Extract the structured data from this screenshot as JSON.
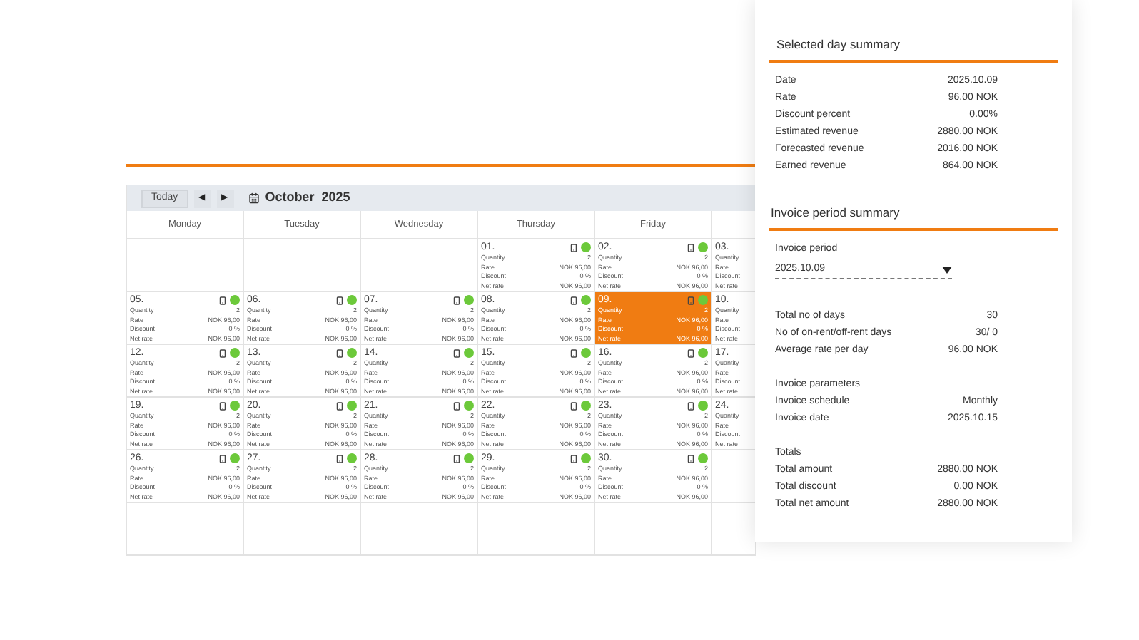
{
  "calendar": {
    "today_button": "Today",
    "prev_button": "◀",
    "next_button": "▶",
    "month": "October  2025",
    "weekdays": [
      "Monday",
      "Tuesday",
      "Wednesday",
      "Thursday",
      "Friday"
    ],
    "weeks": [
      [
        {
          "kind": "empty"
        },
        {
          "kind": "empty"
        },
        {
          "kind": "empty"
        },
        {
          "date": "01.",
          "selected": false,
          "rows": [
            {
              "label": "Quantity",
              "value": "2"
            },
            {
              "label": "Rate",
              "value": "NOK 96,00"
            },
            {
              "label": "Discount",
              "value": "0 %"
            },
            {
              "label": "Net rate",
              "value": "NOK 96,00"
            }
          ]
        },
        {
          "date": "02.",
          "selected": false,
          "rows": [
            {
              "label": "Quantity",
              "value": "2"
            },
            {
              "label": "Rate",
              "value": "NOK 96,00"
            },
            {
              "label": "Discount",
              "value": "0 %"
            },
            {
              "label": "Net rate",
              "value": "NOK 96,00"
            }
          ]
        },
        {
          "date": "03.",
          "kind": "partial",
          "rows": [
            {
              "label": "Quantity"
            },
            {
              "label": "Rate"
            },
            {
              "label": "Discount"
            },
            {
              "label": "Net rate"
            }
          ]
        }
      ],
      [
        {
          "date": "05.",
          "selected": false,
          "rows": [
            {
              "label": "Quantity",
              "value": "2"
            },
            {
              "label": "Rate",
              "value": "NOK 96,00"
            },
            {
              "label": "Discount",
              "value": "0 %"
            },
            {
              "label": "Net rate",
              "value": "NOK 96,00"
            }
          ]
        },
        {
          "date": "06.",
          "selected": false,
          "rows": [
            {
              "label": "Quantity",
              "value": "2"
            },
            {
              "label": "Rate",
              "value": "NOK 96,00"
            },
            {
              "label": "Discount",
              "value": "0 %"
            },
            {
              "label": "Net rate",
              "value": "NOK 96,00"
            }
          ]
        },
        {
          "date": "07.",
          "selected": false,
          "rows": [
            {
              "label": "Quantity",
              "value": "2"
            },
            {
              "label": "Rate",
              "value": "NOK 96,00"
            },
            {
              "label": "Discount",
              "value": "0 %"
            },
            {
              "label": "Net rate",
              "value": "NOK 96,00"
            }
          ]
        },
        {
          "date": "08.",
          "selected": false,
          "rows": [
            {
              "label": "Quantity",
              "value": "2"
            },
            {
              "label": "Rate",
              "value": "NOK 96,00"
            },
            {
              "label": "Discount",
              "value": "0 %"
            },
            {
              "label": "Net rate",
              "value": "NOK 96,00"
            }
          ]
        },
        {
          "date": "09.",
          "selected": true,
          "rows": [
            {
              "label": "Quantity",
              "value": "2"
            },
            {
              "label": "Rate",
              "value": "NOK 96,00"
            },
            {
              "label": "Discount",
              "value": "0 %"
            },
            {
              "label": "Net rate",
              "value": "NOK 96,00"
            }
          ]
        },
        {
          "date": "10.",
          "kind": "partial",
          "rows": [
            {
              "label": "Quantity"
            },
            {
              "label": "Rate"
            },
            {
              "label": "Discount"
            },
            {
              "label": "Net rate"
            }
          ]
        }
      ],
      [
        {
          "date": "12.",
          "selected": false,
          "rows": [
            {
              "label": "Quantity",
              "value": "2"
            },
            {
              "label": "Rate",
              "value": "NOK 96,00"
            },
            {
              "label": "Discount",
              "value": "0 %"
            },
            {
              "label": "Net rate",
              "value": "NOK 96,00"
            }
          ]
        },
        {
          "date": "13.",
          "selected": false,
          "rows": [
            {
              "label": "Quantity",
              "value": "2"
            },
            {
              "label": "Rate",
              "value": "NOK 96,00"
            },
            {
              "label": "Discount",
              "value": "0 %"
            },
            {
              "label": "Net rate",
              "value": "NOK 96,00"
            }
          ]
        },
        {
          "date": "14.",
          "selected": false,
          "rows": [
            {
              "label": "Quantity",
              "value": "2"
            },
            {
              "label": "Rate",
              "value": "NOK 96,00"
            },
            {
              "label": "Discount",
              "value": "0 %"
            },
            {
              "label": "Net rate",
              "value": "NOK 96,00"
            }
          ]
        },
        {
          "date": "15.",
          "selected": false,
          "rows": [
            {
              "label": "Quantity",
              "value": "2"
            },
            {
              "label": "Rate",
              "value": "NOK 96,00"
            },
            {
              "label": "Discount",
              "value": "0 %"
            },
            {
              "label": "Net rate",
              "value": "NOK 96,00"
            }
          ]
        },
        {
          "date": "16.",
          "selected": false,
          "rows": [
            {
              "label": "Quantity",
              "value": "2"
            },
            {
              "label": "Rate",
              "value": "NOK 96,00"
            },
            {
              "label": "Discount",
              "value": "0 %"
            },
            {
              "label": "Net rate",
              "value": "NOK 96,00"
            }
          ]
        },
        {
          "date": "17.",
          "kind": "partial",
          "rows": [
            {
              "label": "Quantity"
            },
            {
              "label": "Rate"
            },
            {
              "label": "Discount"
            },
            {
              "label": "Net rate"
            }
          ]
        }
      ],
      [
        {
          "date": "19.",
          "selected": false,
          "rows": [
            {
              "label": "Quantity",
              "value": "2"
            },
            {
              "label": "Rate",
              "value": "NOK 96,00"
            },
            {
              "label": "Discount",
              "value": "0 %"
            },
            {
              "label": "Net rate",
              "value": "NOK 96,00"
            }
          ]
        },
        {
          "date": "20.",
          "selected": false,
          "rows": [
            {
              "label": "Quantity",
              "value": "2"
            },
            {
              "label": "Rate",
              "value": "NOK 96,00"
            },
            {
              "label": "Discount",
              "value": "0 %"
            },
            {
              "label": "Net rate",
              "value": "NOK 96,00"
            }
          ]
        },
        {
          "date": "21.",
          "selected": false,
          "rows": [
            {
              "label": "Quantity",
              "value": "2"
            },
            {
              "label": "Rate",
              "value": "NOK 96,00"
            },
            {
              "label": "Discount",
              "value": "0 %"
            },
            {
              "label": "Net rate",
              "value": "NOK 96,00"
            }
          ]
        },
        {
          "date": "22.",
          "selected": false,
          "rows": [
            {
              "label": "Quantity",
              "value": "2"
            },
            {
              "label": "Rate",
              "value": "NOK 96,00"
            },
            {
              "label": "Discount",
              "value": "0 %"
            },
            {
              "label": "Net rate",
              "value": "NOK 96,00"
            }
          ]
        },
        {
          "date": "23.",
          "selected": false,
          "rows": [
            {
              "label": "Quantity",
              "value": "2"
            },
            {
              "label": "Rate",
              "value": "NOK 96,00"
            },
            {
              "label": "Discount",
              "value": "0 %"
            },
            {
              "label": "Net rate",
              "value": "NOK 96,00"
            }
          ]
        },
        {
          "date": "24.",
          "kind": "partial",
          "rows": [
            {
              "label": "Quantity"
            },
            {
              "label": "Rate"
            },
            {
              "label": "Discount"
            },
            {
              "label": "Net rate"
            }
          ]
        }
      ],
      [
        {
          "date": "26.",
          "selected": false,
          "rows": [
            {
              "label": "Quantity",
              "value": "2"
            },
            {
              "label": "Rate",
              "value": "NOK 96,00"
            },
            {
              "label": "Discount",
              "value": "0 %"
            },
            {
              "label": "Net rate",
              "value": "NOK 96,00"
            }
          ]
        },
        {
          "date": "27.",
          "selected": false,
          "rows": [
            {
              "label": "Quantity",
              "value": "2"
            },
            {
              "label": "Rate",
              "value": "NOK 96,00"
            },
            {
              "label": "Discount",
              "value": "0 %"
            },
            {
              "label": "Net rate",
              "value": "NOK 96,00"
            }
          ]
        },
        {
          "date": "28.",
          "selected": false,
          "rows": [
            {
              "label": "Quantity",
              "value": "2"
            },
            {
              "label": "Rate",
              "value": "NOK 96,00"
            },
            {
              "label": "Discount",
              "value": "0 %"
            },
            {
              "label": "Net rate",
              "value": "NOK 96,00"
            }
          ]
        },
        {
          "date": "29.",
          "selected": false,
          "rows": [
            {
              "label": "Quantity",
              "value": "2"
            },
            {
              "label": "Rate",
              "value": "NOK 96,00"
            },
            {
              "label": "Discount",
              "value": "0 %"
            },
            {
              "label": "Net rate",
              "value": "NOK 96,00"
            }
          ]
        },
        {
          "date": "30.",
          "selected": false,
          "rows": [
            {
              "label": "Quantity",
              "value": "2"
            },
            {
              "label": "Rate",
              "value": "NOK 96,00"
            },
            {
              "label": "Discount",
              "value": "0 %"
            },
            {
              "label": "Net rate",
              "value": "NOK 96,00"
            }
          ]
        },
        {
          "kind": "empty"
        }
      ],
      [
        {
          "kind": "empty"
        },
        {
          "kind": "empty"
        },
        {
          "kind": "empty"
        },
        {
          "kind": "empty"
        },
        {
          "kind": "empty"
        },
        {
          "kind": "empty"
        }
      ]
    ]
  },
  "selected_day_summary": {
    "title": "Selected day summary",
    "rows": [
      {
        "label": "Date",
        "value": "2025.10.09"
      },
      {
        "label": "Rate",
        "value": "96.00 NOK"
      },
      {
        "label": "Discount percent",
        "value": "0.00%"
      },
      {
        "label": "Estimated revenue",
        "value": "2880.00 NOK"
      },
      {
        "label": "Forecasted revenue",
        "value": "2016.00 NOK"
      },
      {
        "label": "Earned revenue",
        "value": "864.00 NOK"
      }
    ]
  },
  "invoice_period_summary": {
    "title": "Invoice period summary",
    "period_label": "Invoice period",
    "period_value": "2025.10.09",
    "groups": [
      {
        "rows": [
          {
            "label": "Total no of days",
            "value": "30"
          },
          {
            "label": "No of on-rent/off-rent days",
            "value": "30/ 0"
          },
          {
            "label": "Average rate per day",
            "value": "96.00 NOK"
          }
        ]
      },
      {
        "heading": "Invoice parameters",
        "rows": [
          {
            "label": "Invoice schedule",
            "value": "Monthly"
          },
          {
            "label": "Invoice date",
            "value": "2025.10.15"
          }
        ]
      },
      {
        "heading": "Totals",
        "rows": [
          {
            "label": "Total amount",
            "value": "2880.00 NOK"
          },
          {
            "label": "Total discount",
            "value": "0.00 NOK"
          },
          {
            "label": "Total net amount",
            "value": "2880.00 NOK"
          }
        ]
      }
    ]
  }
}
